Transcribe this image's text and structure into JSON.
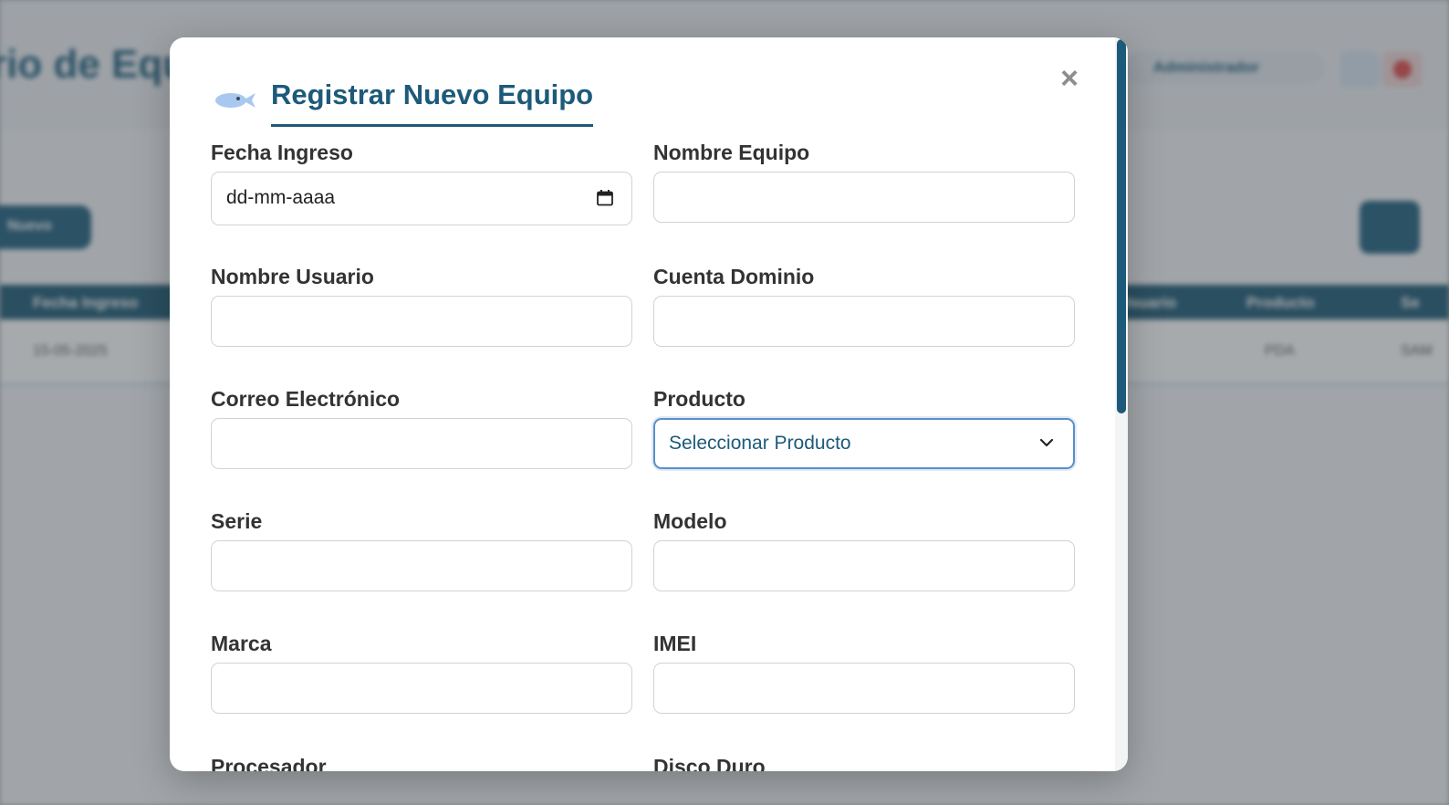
{
  "background": {
    "title": "rio de Equipos",
    "user": "Administrador",
    "left_button": "Nuevo",
    "table_headers": [
      "Fecha Ingreso",
      "Usuario",
      "Producto",
      "Se"
    ],
    "table_row": [
      "15-05-2025",
      "",
      "PDA",
      "SAM"
    ]
  },
  "modal": {
    "title": "Registrar Nuevo Equipo",
    "close_symbol": "×",
    "fields": {
      "fecha_ingreso": {
        "label": "Fecha Ingreso",
        "value": "dd-mm-aaaa"
      },
      "nombre_equipo": {
        "label": "Nombre Equipo",
        "value": ""
      },
      "nombre_usuario": {
        "label": "Nombre Usuario",
        "value": ""
      },
      "cuenta_dominio": {
        "label": "Cuenta Dominio",
        "value": ""
      },
      "correo": {
        "label": "Correo Electrónico",
        "value": ""
      },
      "producto": {
        "label": "Producto",
        "value": "Seleccionar Producto"
      },
      "serie": {
        "label": "Serie",
        "value": ""
      },
      "modelo": {
        "label": "Modelo",
        "value": ""
      },
      "marca": {
        "label": "Marca",
        "value": ""
      },
      "imei": {
        "label": "IMEI",
        "value": ""
      },
      "procesador": {
        "label": "Procesador"
      },
      "disco_duro": {
        "label": "Disco Duro"
      }
    }
  },
  "colors": {
    "accent": "#1d5a7a",
    "focus_border": "#5b8fc9",
    "label": "#333333",
    "close": "#8e8e8e",
    "fish_icon": "#a9c8ef"
  },
  "icons": [
    "fish-icon",
    "close-icon",
    "calendar-icon",
    "chevron-down-icon"
  ]
}
